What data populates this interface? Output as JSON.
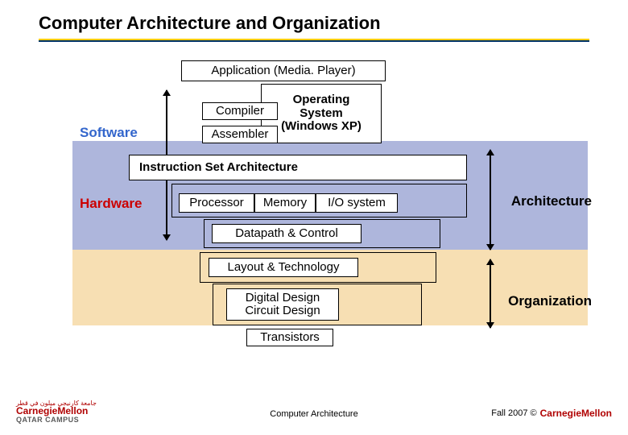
{
  "title": "Computer Architecture and Organization",
  "boxes": {
    "application": "Application (Media. Player)",
    "compiler": "Compiler",
    "assembler": "Assembler",
    "os": "Operating\nSystem\n(Windows XP)",
    "isa": "Instruction Set Architecture",
    "processor": "Processor",
    "memory": "Memory",
    "io": "I/O system",
    "datapath": "Datapath & Control",
    "layout": "Layout & Technology",
    "digital": "Digital Design\nCircuit Design",
    "transistors": "Transistors"
  },
  "labels": {
    "software": "Software",
    "hardware": "Hardware",
    "architecture": "Architecture",
    "organization": "Organization"
  },
  "footer": {
    "center": "Computer Architecture",
    "right_text": "Fall 2007 ©",
    "cm_arabic": "جامعة كارنيجي ميلون في قطر",
    "cm_main": "CarnegieMellon",
    "cm_sub": "QATAR CAMPUS"
  }
}
